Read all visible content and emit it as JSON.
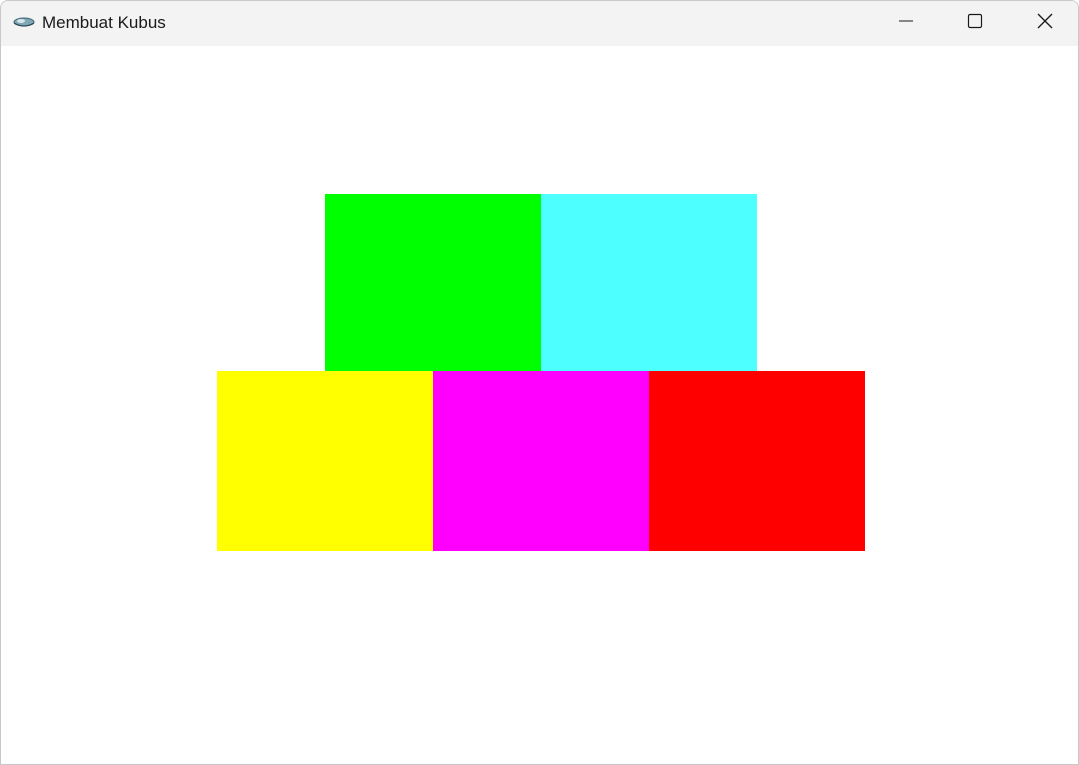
{
  "window": {
    "title": "Membuat Kubus",
    "app_icon": "opengl-app-icon",
    "controls": {
      "minimize_icon": "minimize-icon",
      "maximize_icon": "maximize-icon",
      "close_icon": "close-icon"
    }
  },
  "canvas": {
    "background": "#ffffff",
    "faces": [
      {
        "name": "green",
        "color": "#00ff00"
      },
      {
        "name": "cyan",
        "color": "#4dffff"
      },
      {
        "name": "yellow",
        "color": "#ffff00"
      },
      {
        "name": "magenta",
        "color": "#ff00ff"
      },
      {
        "name": "red",
        "color": "#ff0000"
      }
    ]
  }
}
